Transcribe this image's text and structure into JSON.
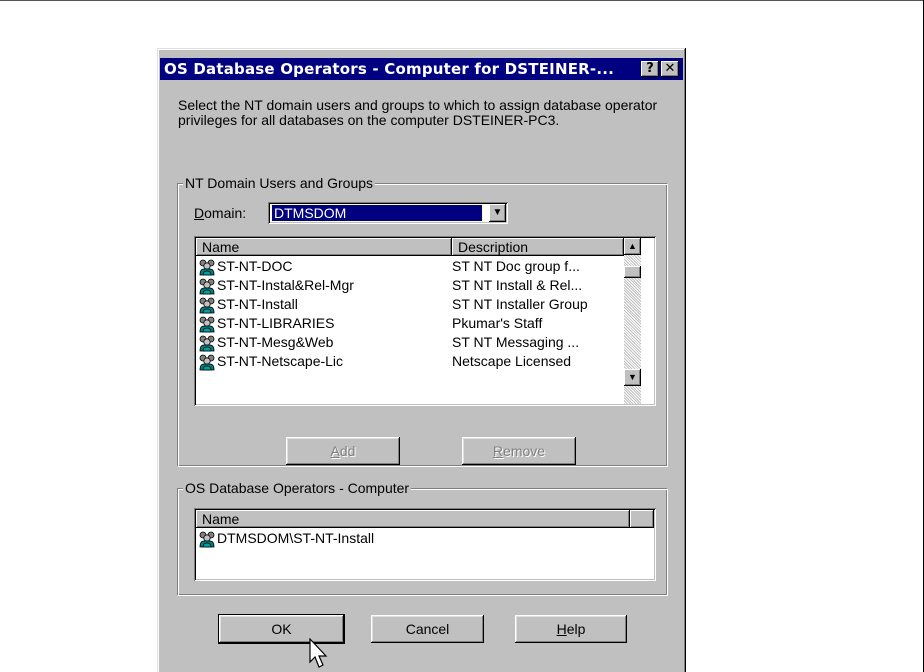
{
  "dialog": {
    "title": "OS Database Operators - Computer for DSTEINER-...",
    "help_button": "?",
    "close_button": "✕",
    "instructions": "Select the NT domain users and groups to which to assign database operator privileges for all databases on the computer DSTEINER-PC3."
  },
  "domain_group": {
    "label": "NT Domain Users and Groups",
    "domain_label": "Domain:",
    "domain_value": "DTMSDOM",
    "columns": [
      "Name",
      "Description"
    ],
    "rows": [
      {
        "name": "ST-NT-DOC",
        "description": "ST NT Doc group f..."
      },
      {
        "name": "ST-NT-Instal&Rel-Mgr",
        "description": "ST NT Install & Rel..."
      },
      {
        "name": "ST-NT-Install",
        "description": "ST NT Installer Group"
      },
      {
        "name": "ST-NT-LIBRARIES",
        "description": "Pkumar's Staff"
      },
      {
        "name": "ST-NT-Mesg&Web",
        "description": "ST NT Messaging ..."
      },
      {
        "name": "ST-NT-Netscape-Lic",
        "description": "Netscape Licensed"
      }
    ]
  },
  "actions": {
    "add_label": "Add",
    "remove_label": "Remove"
  },
  "operators_group": {
    "label": "OS Database Operators - Computer",
    "column": "Name",
    "rows": [
      {
        "name": "DTMSDOM\\ST-NT-Install"
      }
    ]
  },
  "footer": {
    "ok_label": "OK",
    "cancel_label": "Cancel",
    "help_label": "Help"
  },
  "icons": {
    "group": "user-group-icon",
    "pointer": "mouse-pointer-icon"
  },
  "colors": {
    "titlebar": "#000080",
    "face": "#c0c0c0",
    "selection": "#000080"
  }
}
